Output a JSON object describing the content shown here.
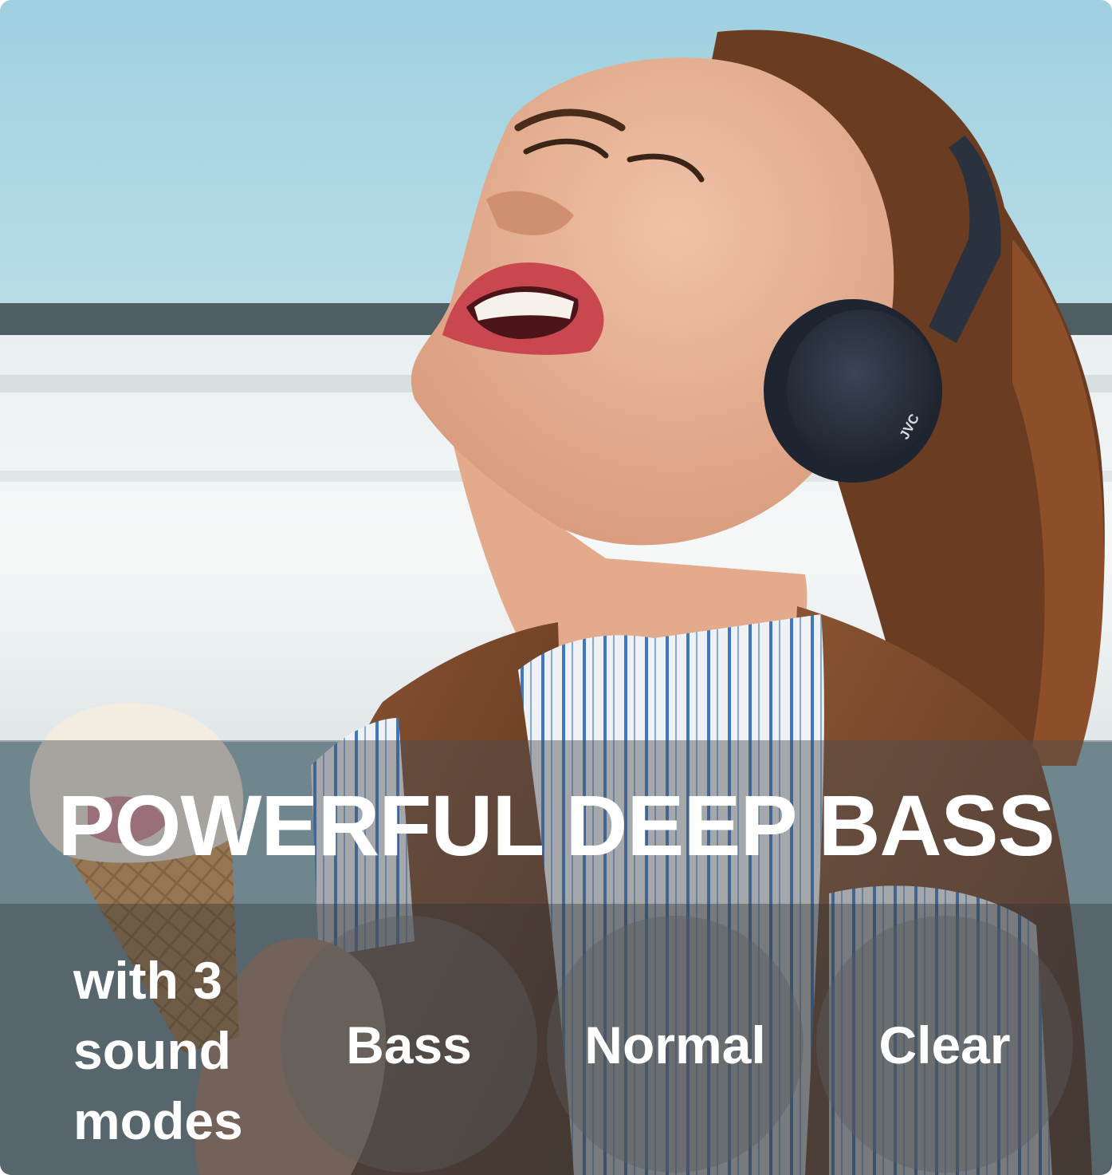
{
  "banner": {
    "headline": "POWERFUL DEEP BASS",
    "modes_intro": "with 3 sound modes",
    "modes": [
      {
        "label": "Bass"
      },
      {
        "label": "Normal"
      },
      {
        "label": "Clear"
      }
    ]
  },
  "product": {
    "brand_mark": "JVC"
  },
  "colors": {
    "text": "#ffffff",
    "sky": "#a9d3df",
    "vest": "#6b3f22",
    "headphones": "#2c3441",
    "hair": "#5a3420"
  }
}
